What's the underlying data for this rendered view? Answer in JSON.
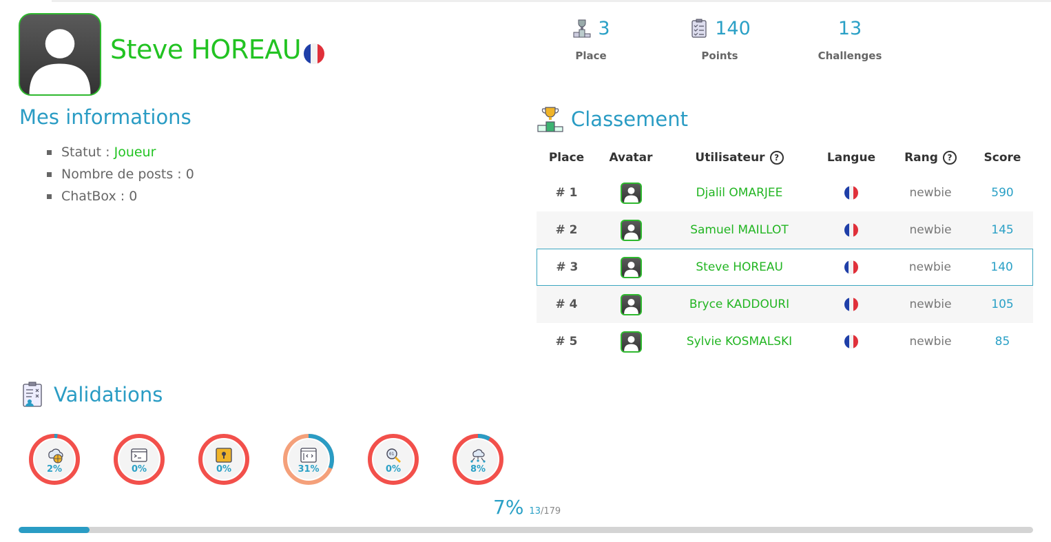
{
  "profile": {
    "name": "Steve HOREAU",
    "country_flag": "flag-fr-icon"
  },
  "stats": [
    {
      "value": "3",
      "label": "Place",
      "icon": "podium-trophy-icon"
    },
    {
      "value": "140",
      "label": "Points",
      "icon": "clipboard-checklist-icon"
    },
    {
      "value": "13",
      "label": "Challenges",
      "icon": ""
    }
  ],
  "info": {
    "title": "Mes informations",
    "statut_label": "Statut : ",
    "statut_value": "Joueur",
    "posts": "Nombre de posts : 0",
    "chatbox": "ChatBox : 0"
  },
  "ranking": {
    "title": "Classement",
    "headers": {
      "place": "Place",
      "avatar": "Avatar",
      "user": "Utilisateur",
      "lang": "Langue",
      "rank": "Rang",
      "score": "Score"
    },
    "help_glyph": "?",
    "rows": [
      {
        "place": "# 1",
        "user": "Djalil OMARJEE",
        "rank": "newbie",
        "score": "590"
      },
      {
        "place": "# 2",
        "user": "Samuel MAILLOT",
        "rank": "newbie",
        "score": "145"
      },
      {
        "place": "# 3",
        "user": "Steve HOREAU",
        "rank": "newbie",
        "score": "140"
      },
      {
        "place": "# 4",
        "user": "Bryce KADDOURI",
        "rank": "newbie",
        "score": "105"
      },
      {
        "place": "# 5",
        "user": "Sylvie KOSMALSKI",
        "rank": "newbie",
        "score": "85"
      }
    ]
  },
  "validations": {
    "title": "Validations",
    "categories": [
      {
        "pct_label": "2%",
        "fraction": 0.02,
        "icon": "cloud-web-icon"
      },
      {
        "pct_label": "0%",
        "fraction": 0.0,
        "icon": "terminal-window-icon"
      },
      {
        "pct_label": "0%",
        "fraction": 0.0,
        "icon": "lock-window-icon"
      },
      {
        "pct_label": "31%",
        "fraction": 0.31,
        "icon": "code-window-icon"
      },
      {
        "pct_label": "0%",
        "fraction": 0.0,
        "icon": "binary-magnifier-icon"
      },
      {
        "pct_label": "8%",
        "fraction": 0.08,
        "icon": "cloud-network-icon"
      }
    ],
    "total_pct": "7%",
    "done": "13",
    "total": "/179",
    "progress_fraction": 0.07
  },
  "colors": {
    "accent_blue": "#2a9cc4",
    "green": "#22c322",
    "ring_low": "#f2504b",
    "ring_mid": "#f4a07a"
  }
}
